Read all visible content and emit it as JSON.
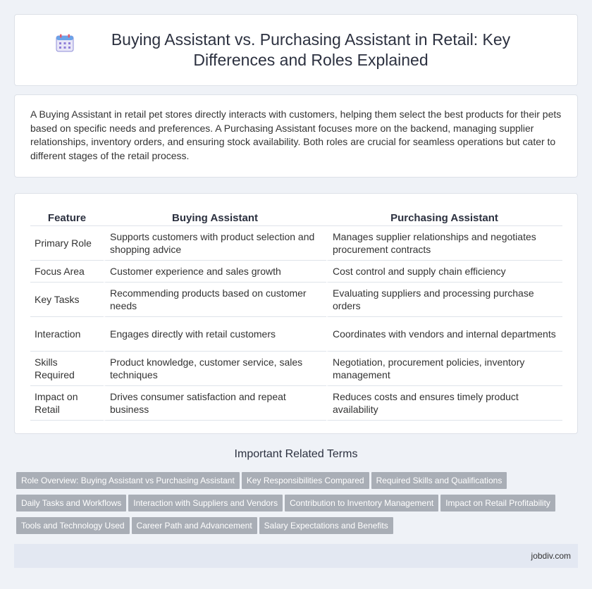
{
  "header": {
    "icon": "calendar-icon",
    "title": "Buying Assistant vs. Purchasing Assistant in Retail: Key Differences and Roles Explained"
  },
  "intro": {
    "text": "A Buying Assistant in retail pet stores directly interacts with customers, helping them select the best products for their pets based on specific needs and preferences. A Purchasing Assistant focuses more on the backend, managing supplier relationships, inventory orders, and ensuring stock availability. Both roles are crucial for seamless operations but cater to different stages of the retail process."
  },
  "table": {
    "headers": [
      "Feature",
      "Buying Assistant",
      "Purchasing Assistant"
    ],
    "rows": [
      [
        "Primary Role",
        "Supports customers with product selection and shopping advice",
        "Manages supplier relationships and negotiates procurement contracts"
      ],
      [
        "Focus Area",
        "Customer experience and sales growth",
        "Cost control and supply chain efficiency"
      ],
      [
        "Key Tasks",
        "Recommending products based on customer needs",
        "Evaluating suppliers and processing purchase orders"
      ],
      [
        "Interaction",
        "Engages directly with retail customers",
        "Coordinates with vendors and internal departments"
      ],
      [
        "Skills Required",
        "Product knowledge, customer service, sales techniques",
        "Negotiation, procurement policies, inventory management"
      ],
      [
        "Impact on Retail",
        "Drives consumer satisfaction and repeat business",
        "Reduces costs and ensures timely product availability"
      ]
    ]
  },
  "related": {
    "title": "Important Related Terms",
    "tags": [
      "Role Overview: Buying Assistant vs Purchasing Assistant",
      "Key Responsibilities Compared",
      "Required Skills and Qualifications",
      "Daily Tasks and Workflows",
      "Interaction with Suppliers and Vendors",
      "Contribution to Inventory Management",
      "Impact on Retail Profitability",
      "Tools and Technology Used",
      "Career Path and Advancement",
      "Salary Expectations and Benefits"
    ]
  },
  "footer": {
    "text": "jobdiv.com"
  }
}
